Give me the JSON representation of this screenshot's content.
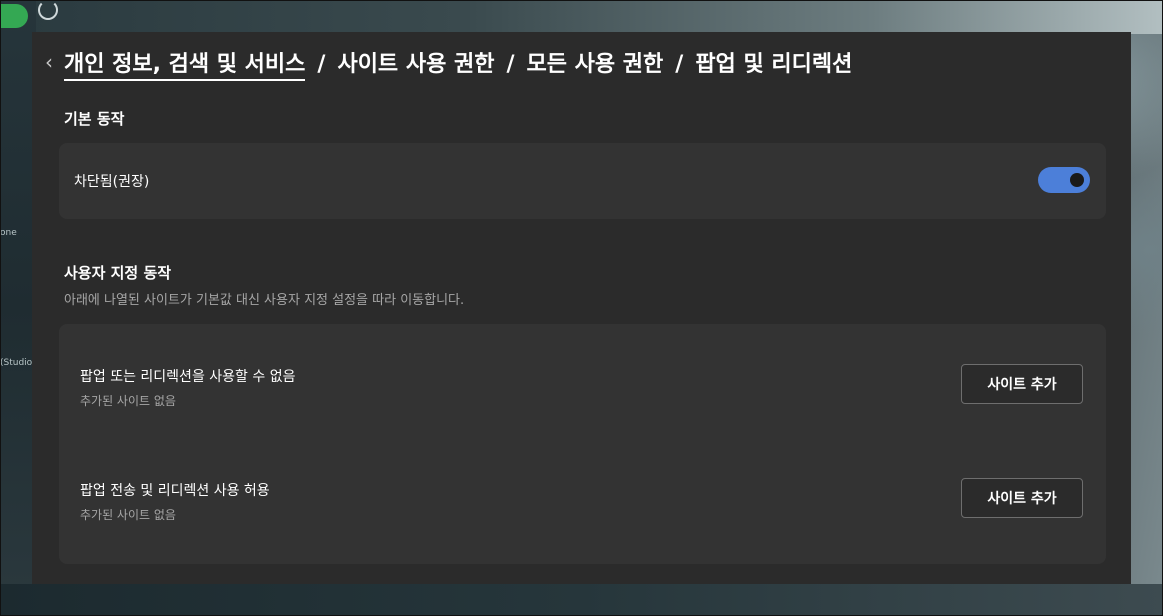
{
  "breadcrumb": {
    "back_icon": "chevron-left-icon",
    "items": [
      "개인 정보, 검색 및 서비스",
      "사이트 사용 권한",
      "모든 사용 권한",
      "팝업 및 리디렉션"
    ],
    "separator": "/"
  },
  "default_behavior": {
    "title": "기본 동작",
    "setting_label": "차단됨(권장)",
    "toggle_on": true,
    "toggle_color": "#4c7fd9"
  },
  "custom_behavior": {
    "title": "사용자 지정 동작",
    "description": "아래에 나열된 사이트가 기본값 대신 사용자 지정 설정을 따라 이동합니다.",
    "sections": [
      {
        "label": "팝업 또는 리디렉션을 사용할 수 없음",
        "sub": "추가된 사이트 없음",
        "button": "사이트 추가"
      },
      {
        "label": "팝업 전송 및 리디렉션 사용 허용",
        "sub": "추가된 사이트 없음",
        "button": "사이트 추가"
      }
    ]
  },
  "background": {
    "left_texts": [
      "one",
      "(Studio"
    ]
  }
}
